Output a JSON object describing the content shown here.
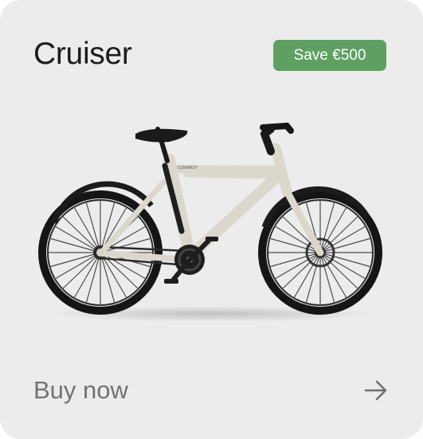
{
  "card": {
    "title": "Cruiser",
    "badge": "Save €500",
    "cta": "Buy now",
    "icons": {
      "product": "bike-image",
      "cta": "arrow-right-icon"
    },
    "colors": {
      "background": "#ececec",
      "badge": "#5f9f62",
      "title": "#1c1c1c",
      "cta": "#737373",
      "frame": "#dcd7cc"
    }
  }
}
